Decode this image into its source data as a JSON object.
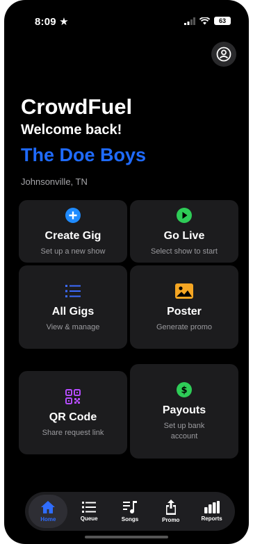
{
  "status_bar": {
    "time": "8:09",
    "battery": "63"
  },
  "header": {
    "app_title": "CrowdFuel",
    "welcome": "Welcome back!",
    "band_name": "The Doe Boys",
    "location": "Johnsonville, TN"
  },
  "cards": [
    {
      "title": "Create Gig",
      "subtitle": "Set up a new show",
      "icon": "plus-circle-icon",
      "color": "#1f8bff"
    },
    {
      "title": "Go Live",
      "subtitle": "Select show to start",
      "icon": "play-circle-icon",
      "color": "#2ecc57"
    },
    {
      "title": "All Gigs",
      "subtitle": "View & manage",
      "icon": "list-icon",
      "color": "#3d6bff"
    },
    {
      "title": "Poster",
      "subtitle": "Generate promo",
      "icon": "image-icon",
      "color": "#f5a623"
    },
    {
      "title": "QR Code",
      "subtitle": "Share request link",
      "icon": "qr-code-icon",
      "color": "#b44cff"
    },
    {
      "title": "Payouts",
      "subtitle": "Set up bank account",
      "icon": "dollar-circle-icon",
      "color": "#2ecc57"
    }
  ],
  "tab_bar": {
    "items": [
      {
        "label": "Home",
        "icon": "home-icon",
        "active": true
      },
      {
        "label": "Queue",
        "icon": "queue-list-icon",
        "active": false
      },
      {
        "label": "Songs",
        "icon": "music-note-icon",
        "active": false
      },
      {
        "label": "Promo",
        "icon": "share-icon",
        "active": false
      },
      {
        "label": "Reports",
        "icon": "bar-chart-icon",
        "active": false
      }
    ]
  },
  "accent_colors": {
    "brand_blue": "#1f6bff",
    "active_tab": "#2f6dff"
  }
}
